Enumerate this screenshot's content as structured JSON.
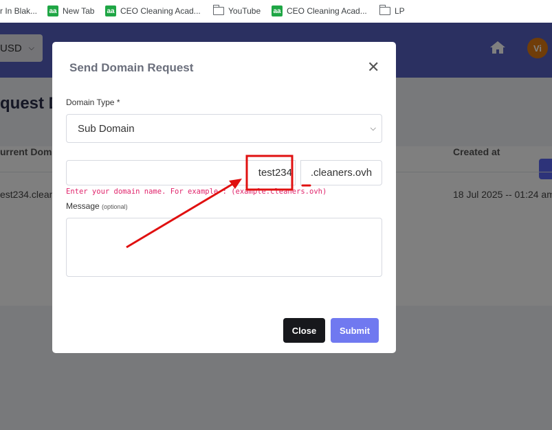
{
  "bookmarks": [
    {
      "label": "r In Blak...",
      "icon": "globe-icon"
    },
    {
      "label": "New Tab",
      "icon": "aa-icon"
    },
    {
      "label": "CEO Cleaning Acad...",
      "icon": "aa-icon"
    },
    {
      "label": "YouTube",
      "icon": "folder-icon"
    },
    {
      "label": "CEO Cleaning Acad...",
      "icon": "aa-icon"
    },
    {
      "label": "LP",
      "icon": "folder-icon"
    }
  ],
  "favicon_text": "aa",
  "header": {
    "currency": "USD",
    "avatar_initials": "Vi",
    "colors": {
      "header_bg": "#5661c2",
      "avatar_bg": "#e07b13"
    }
  },
  "page": {
    "title_partial": "quest D",
    "columns": {
      "current_domain": "urrent Doma",
      "created_at": "Created at"
    },
    "row": {
      "domain": "est234.clean",
      "created_at": "18 Jul 2025 -- 01:24 am"
    }
  },
  "modal": {
    "title": "Send Domain Request",
    "domain_type_label": "Domain Type *",
    "domain_type_value": "Sub Domain",
    "domain_value": "test234",
    "domain_suffix": ".cleaners.ovh",
    "hint": "Enter your domain name. For example : (example.cleaners.ovh)",
    "message_label": "Message",
    "message_optional": "(optional)",
    "message_value": "",
    "close_label": "Close",
    "submit_label": "Submit",
    "colors": {
      "submit_bg": "#7079f0",
      "close_bg": "#17181c",
      "hint": "#e0246b"
    }
  },
  "annotation_color": "#e01010"
}
